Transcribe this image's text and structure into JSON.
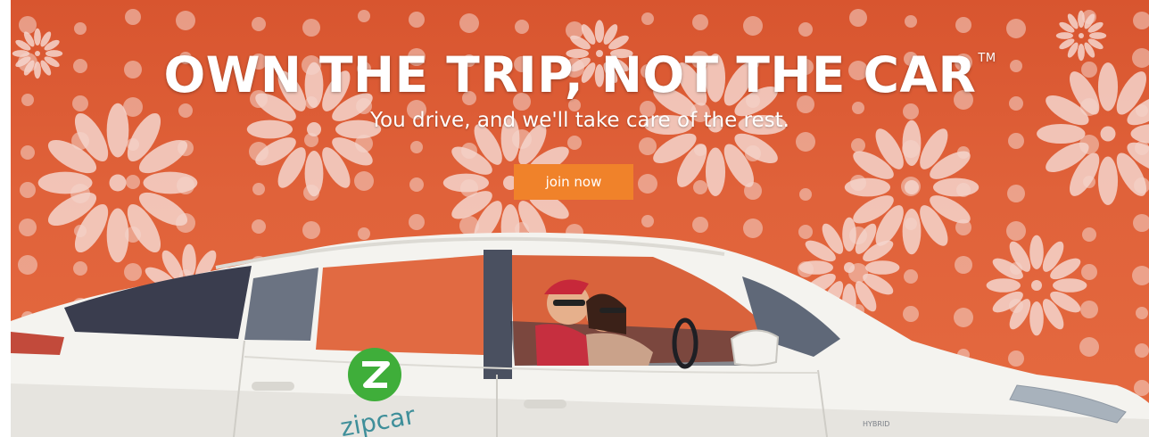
{
  "hero": {
    "headline": "OWN THE TRIP, NOT THE CAR",
    "trademark": "TM",
    "subheadline": "You drive, and we'll take care of the rest.",
    "cta_label": "join now"
  },
  "car": {
    "brand_logo_text": "zipcar",
    "badge_text": "HYBRID"
  },
  "colors": {
    "background": "#e0623a",
    "pattern": "#f4d5cc",
    "cta": "#f0822a",
    "logo_green": "#3fae3a"
  }
}
